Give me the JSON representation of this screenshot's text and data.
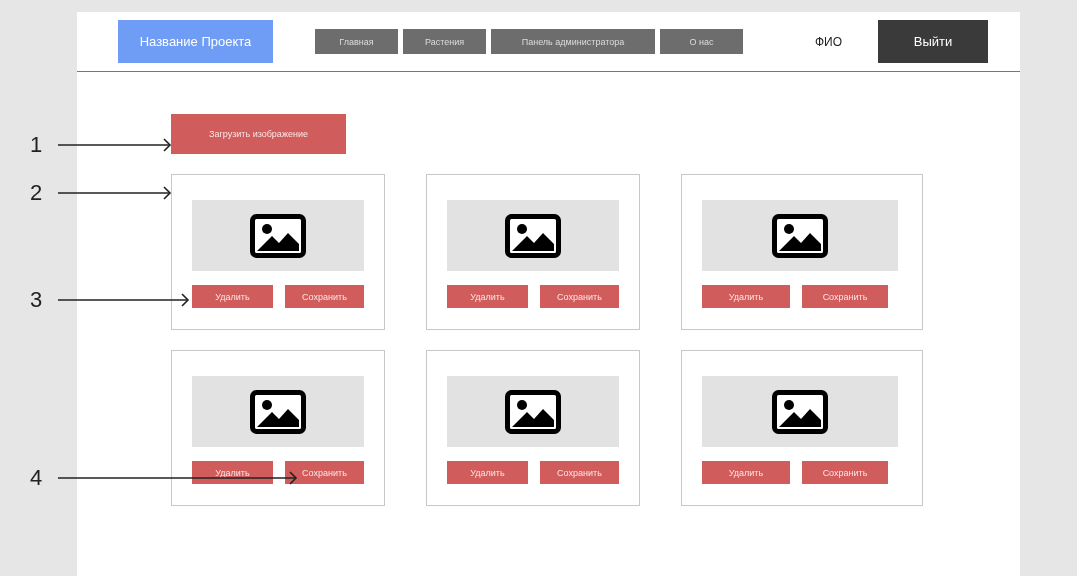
{
  "header": {
    "brand": "Название Проекта",
    "nav": [
      "Главная",
      "Растения",
      "Панель администратора",
      "О нас"
    ],
    "user": "ФИО",
    "logout": "Выйти"
  },
  "upload_button": "Загрузить изображение",
  "cards": [
    {
      "kind": "picture",
      "delete": "Удалить",
      "save": "Сохранить"
    },
    {
      "kind": "picture",
      "delete": "Удалить",
      "save": "Сохранить"
    },
    {
      "kind": "picture",
      "delete": "Удалить",
      "save": "Сохранить"
    },
    {
      "kind": "picture",
      "delete": "Удалить",
      "save": "Сохранить"
    },
    {
      "kind": "picture",
      "delete": "Удалить",
      "save": "Сохранить"
    },
    {
      "kind": "picture",
      "delete": "Удалить",
      "save": "Сохранить"
    }
  ],
  "annotations": [
    {
      "label": "1"
    },
    {
      "label": "2"
    },
    {
      "label": "3"
    },
    {
      "label": "4"
    }
  ]
}
